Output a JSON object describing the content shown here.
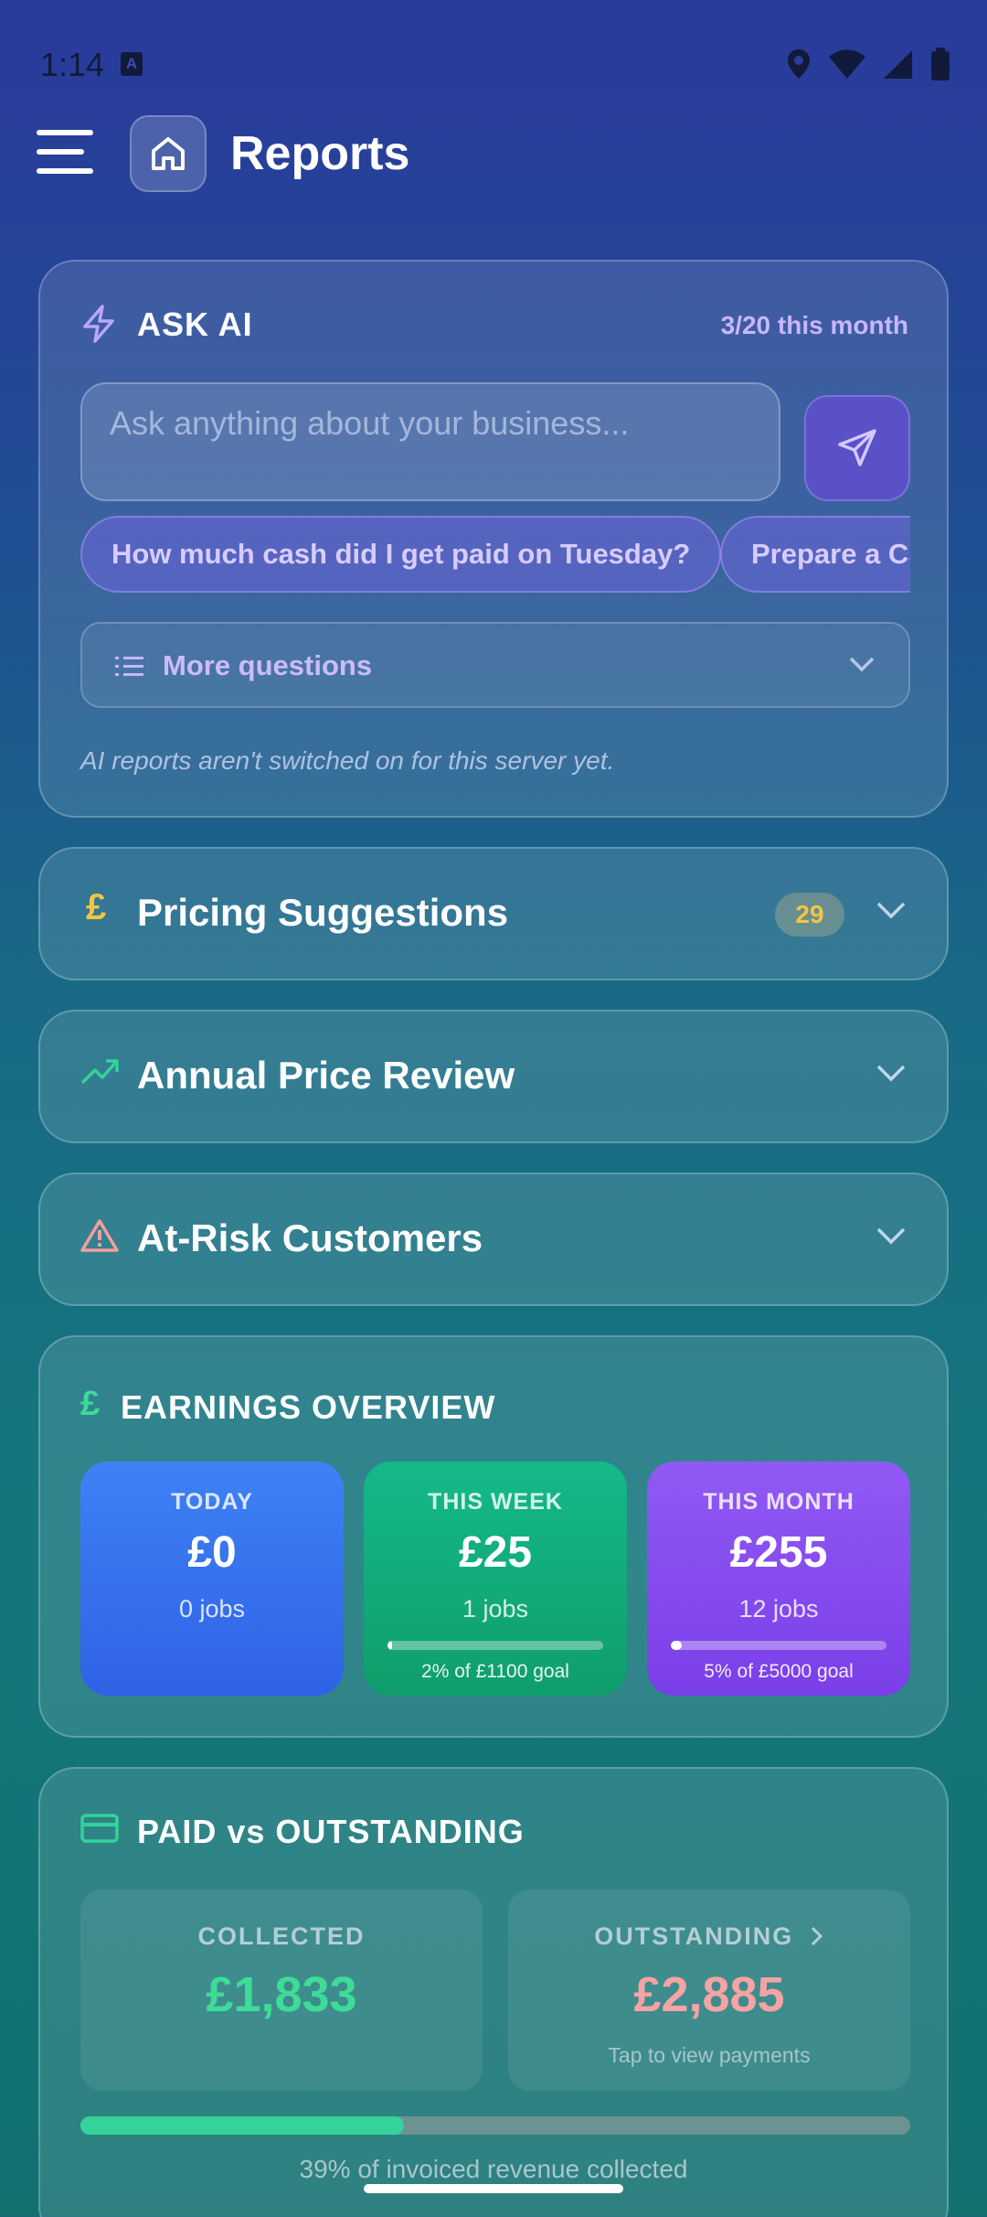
{
  "status_bar": {
    "time": "1:14",
    "badge": "A"
  },
  "header": {
    "title": "Reports"
  },
  "ask_ai": {
    "title": "ASK AI",
    "usage": "3/20 this month",
    "placeholder": "Ask anything about your business...",
    "chips": [
      "How much cash did I get paid on Tuesday?",
      "Prepare a CS"
    ],
    "more_questions": "More questions",
    "note": "AI reports aren't switched on for this server yet."
  },
  "pricing": {
    "symbol": "£",
    "title": "Pricing Suggestions",
    "count": "29"
  },
  "annual": {
    "title": "Annual Price Review"
  },
  "risk": {
    "title": "At-Risk Customers"
  },
  "earnings": {
    "symbol": "£",
    "title": "EARNINGS OVERVIEW",
    "tiles": [
      {
        "label": "TODAY",
        "value": "£0",
        "jobs": "0 jobs"
      },
      {
        "label": "THIS WEEK",
        "value": "£25",
        "jobs": "1 jobs",
        "goal": "2% of £1100 goal",
        "progress_pct": 2
      },
      {
        "label": "THIS MONTH",
        "value": "£255",
        "jobs": "12 jobs",
        "goal": "5% of £5000 goal",
        "progress_pct": 5
      }
    ]
  },
  "paid": {
    "title": "PAID vs OUTSTANDING",
    "collected_label": "COLLECTED",
    "collected_value": "£1,833",
    "outstanding_label": "OUTSTANDING",
    "outstanding_value": "£2,885",
    "outstanding_hint": "Tap to view payments",
    "collected_pct": 39,
    "caption": "39% of invoiced revenue collected"
  },
  "colors": {
    "accent_green": "#34d399",
    "accent_gold": "#f5c542",
    "accent_purple": "#c8b6ff",
    "outstanding_pink": "#f5a3a3"
  }
}
